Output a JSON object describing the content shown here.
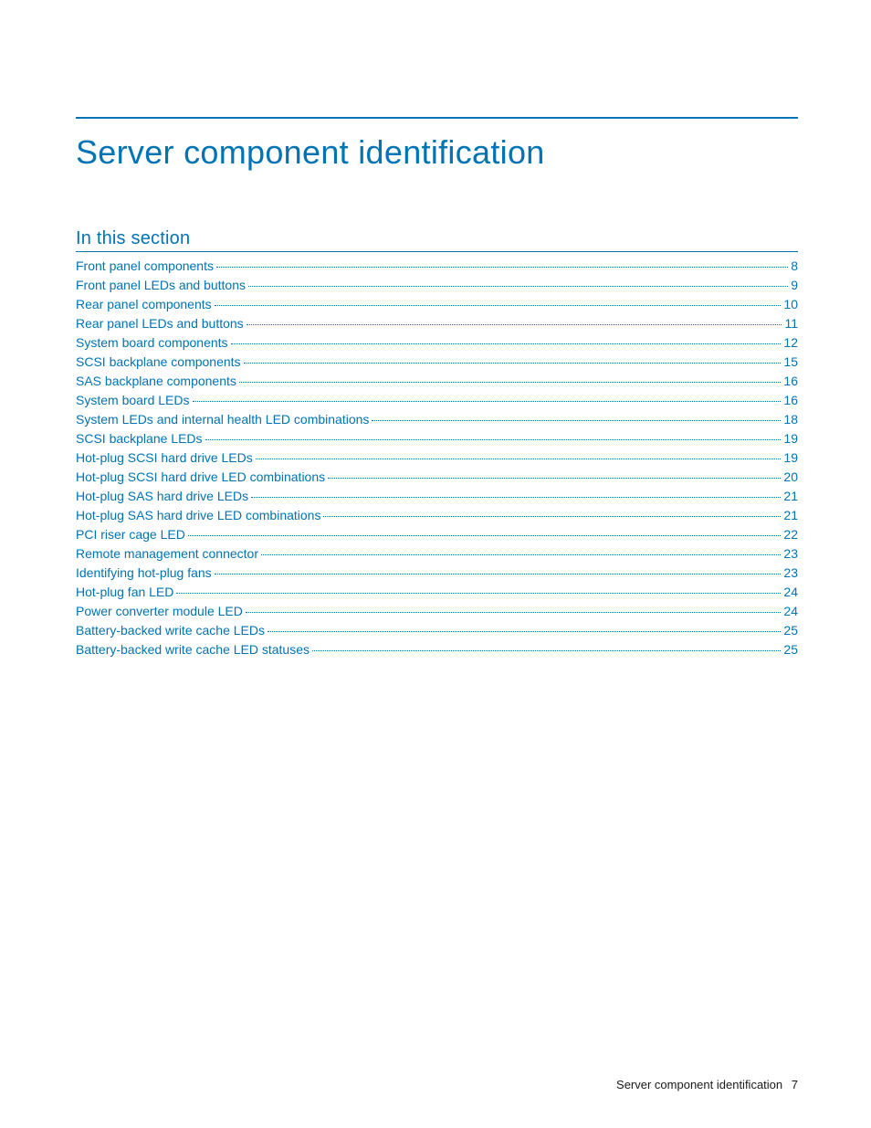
{
  "page_title": "Server component identification",
  "section_heading": "In this section",
  "toc": [
    {
      "label": "Front panel components",
      "page": "8"
    },
    {
      "label": "Front panel LEDs and buttons",
      "page": "9"
    },
    {
      "label": "Rear panel components",
      "page": "10"
    },
    {
      "label": "Rear panel LEDs and buttons",
      "page": "11"
    },
    {
      "label": "System board components",
      "page": "12"
    },
    {
      "label": "SCSI backplane components",
      "page": "15"
    },
    {
      "label": "SAS backplane components",
      "page": "16"
    },
    {
      "label": "System board LEDs",
      "page": "16"
    },
    {
      "label": "System LEDs and internal health LED combinations",
      "page": "18"
    },
    {
      "label": "SCSI backplane LEDs",
      "page": "19"
    },
    {
      "label": "Hot-plug SCSI hard drive LEDs",
      "page": "19"
    },
    {
      "label": "Hot-plug SCSI hard drive LED combinations",
      "page": "20"
    },
    {
      "label": "Hot-plug SAS hard drive LEDs",
      "page": "21"
    },
    {
      "label": "Hot-plug SAS hard drive LED combinations",
      "page": "21"
    },
    {
      "label": "PCI riser cage LED",
      "page": "22"
    },
    {
      "label": "Remote management connector",
      "page": "23"
    },
    {
      "label": "Identifying hot-plug fans",
      "page": "23"
    },
    {
      "label": "Hot-plug fan LED",
      "page": "24"
    },
    {
      "label": "Power converter module LED",
      "page": "24"
    },
    {
      "label": "Battery-backed write cache LEDs",
      "page": "25"
    },
    {
      "label": "Battery-backed write cache LED statuses",
      "page": "25"
    }
  ],
  "footer": {
    "title": "Server component identification",
    "page_number": "7"
  }
}
